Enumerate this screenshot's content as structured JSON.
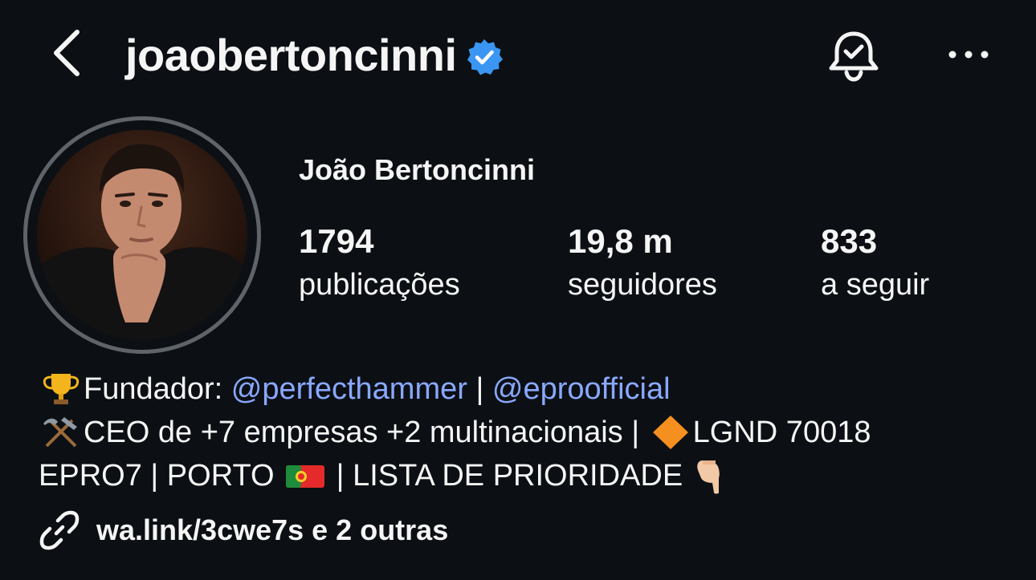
{
  "header": {
    "username": "joaobertoncinni",
    "icons": {
      "back": "chevron-left-icon",
      "verified": "verified-badge-icon",
      "notifications": "bell-check-icon",
      "more": "more-horizontal-icon"
    }
  },
  "profile": {
    "full_name": "João Bertoncinni",
    "stats": [
      {
        "value": "1794",
        "label": "publicações"
      },
      {
        "value": "19,8 m",
        "label": "seguidores"
      },
      {
        "value": "833",
        "label": "a seguir"
      }
    ]
  },
  "bio": {
    "line1": {
      "prefix": "Fundador: ",
      "mention1": "@perfecthammer",
      "separator": " | ",
      "mention2": "@eproofficial"
    },
    "line2": {
      "text1": "CEO de +7 empresas +2 multinacionais | ",
      "text2": "LGND 70018"
    },
    "line3": {
      "text1": "EPRO7 | PORTO ",
      "text2": " | LISTA DE PRIORIDADE "
    },
    "emojis": [
      "trophy-emoji",
      "hammer-pick-emoji",
      "orange-diamond-emoji",
      "portugal-flag-emoji",
      "pointing-down-emoji"
    ]
  },
  "links": {
    "text": "wa.link/3cwe7s e 2 outras",
    "icon": "link-icon"
  },
  "colors": {
    "background": "#0c1014",
    "text": "#f5f5f5",
    "mention": "#8aa8ff",
    "verified": "#3a96f2",
    "avatar_ring": "#5f646a"
  }
}
